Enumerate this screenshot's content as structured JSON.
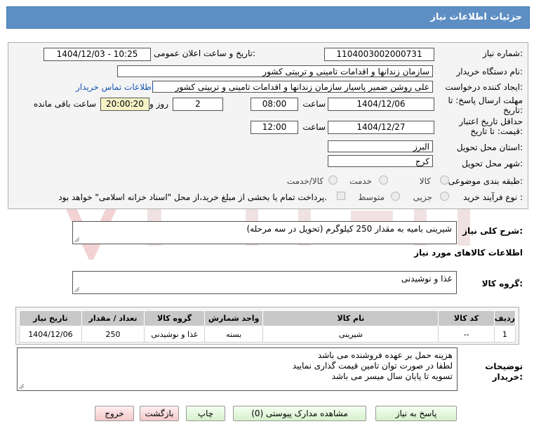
{
  "header": {
    "title": "جزئیات اطلاعات نیاز"
  },
  "form": {
    "need_number_label": "شماره نیاز:",
    "need_number": "1104003002000731",
    "announce_label": "تاریخ و ساعت اعلان عمومی:",
    "announce_value": "1404/12/03 - 10:25",
    "buyer_label": "نام دستگاه خریدار:",
    "buyer_value": "سازمان زندانها و اقدامات تامینی و تربیتی کشور",
    "creator_label": "ایجاد کننده درخواست:",
    "creator_value": "علی روشن ضمیر پاسیار سازمان زندانها و اقدامات تامینی و تربیتی کشور",
    "contact_link": "اطلاعات تماس خریدار",
    "deadline_label_1": "مهلت ارسال پاسخ: تا",
    "deadline_label_2": "تاریخ:",
    "deadline_date": "1404/12/06",
    "time_label": "ساعت",
    "deadline_time": "08:00",
    "days_value": "2",
    "days_label": "روز و",
    "remaining_time": "20:00:20",
    "remaining_label": "ساعت باقی مانده",
    "validity_label_1": "حداقل تاریخ اعتبار",
    "validity_label_2": "قیمت: تا تاریخ:",
    "validity_date": "1404/12/27",
    "validity_time": "12:00",
    "province_label": "استان محل تحویل:",
    "province_value": "البرز",
    "city_label": "شهر محل تحویل:",
    "city_value": "کرج",
    "category_label": "طبقه بندی موضوعی:",
    "category_options": [
      "کالا",
      "خدمت",
      "کالا/خدمت"
    ],
    "process_label": "نوع فرآیند خرید :",
    "process_options": [
      "جزیی",
      "متوسط"
    ],
    "payment_note": "پرداخت تمام یا بخشی از مبلغ خرید،از محل \"اسناد خزانه اسلامی\" خواهد بود."
  },
  "summary": {
    "label": "شرح کلی نیاز:",
    "value": "شیرینی بامیه به مقدار 250 کیلوگرم (تحویل در سه مرحله)"
  },
  "goods": {
    "section_title": "اطلاعات کالاهای مورد نیاز",
    "group_label": "گروه کالا:",
    "group_value": "غذا و نوشیدنی",
    "columns": [
      "ردیف",
      "کد کالا",
      "نام کالا",
      "واحد شمارش",
      "گروه کالا",
      "تعداد / مقدار",
      "تاریخ نیاز"
    ],
    "rows": [
      [
        "1",
        "--",
        "شیرینی",
        "بسته",
        "غذا و نوشیدنی",
        "250",
        "1404/12/06"
      ]
    ]
  },
  "notes": {
    "label_1": "توضیحات",
    "label_2": "خریدار:",
    "lines": [
      "هزینه حمل بر عهده فروشنده می باشد",
      "لطفا در صورت توان تامین قیمت گذاری نمایید",
      "تسویه تا پایان سال میسر می باشد"
    ]
  },
  "buttons": {
    "reply": "پاسخ به نیاز",
    "docs": "مشاهده مدارک پیوستی (0)",
    "print": "چاپ",
    "back": "بازگشت",
    "exit": "خروج"
  },
  "colors": {
    "header": "#5d8ec4",
    "link": "#1a55b4",
    "remaining_bg": "#f5f3c6"
  }
}
